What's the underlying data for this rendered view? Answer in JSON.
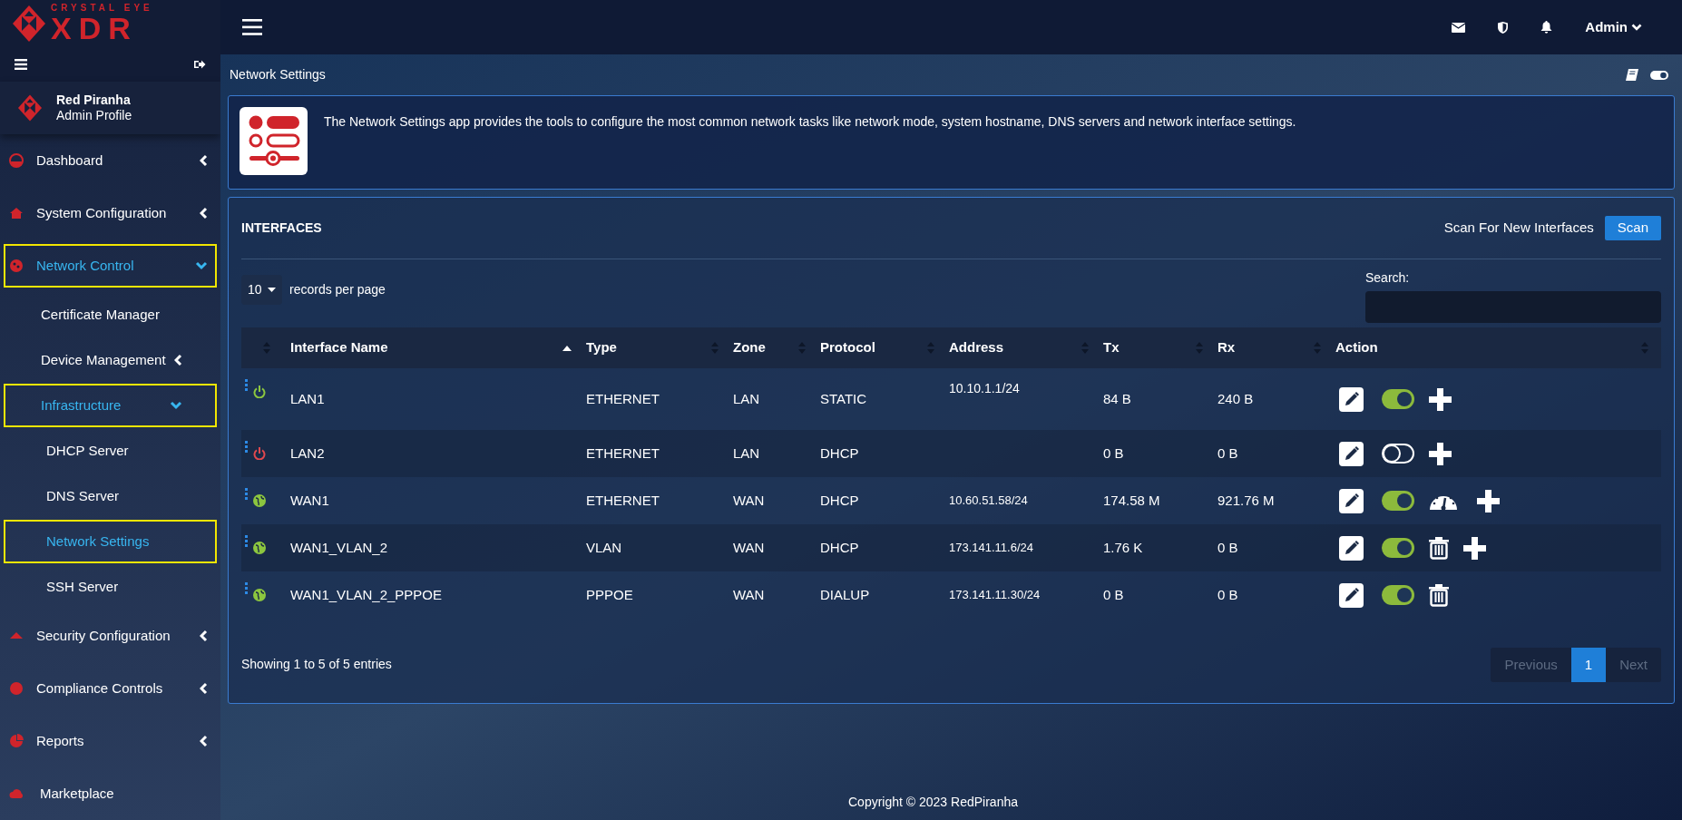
{
  "brand": {
    "top": "CRYSTAL EYE",
    "main": "XDR"
  },
  "topbar": {
    "user": "Admin"
  },
  "profile": {
    "name": "Red Piranha",
    "role": "Admin Profile"
  },
  "sidebar": {
    "items": [
      {
        "label": "Dashboard",
        "selected": false,
        "expanded": false
      },
      {
        "label": "System Configuration",
        "selected": false,
        "expanded": false
      },
      {
        "label": "Network Control",
        "selected": true,
        "expanded": true,
        "children": [
          {
            "label": "Certificate Manager",
            "selected": false
          },
          {
            "label": "Device Management",
            "selected": false,
            "expanded": false
          },
          {
            "label": "Infrastructure",
            "selected": true,
            "expanded": true,
            "children": [
              {
                "label": "DHCP Server",
                "selected": false
              },
              {
                "label": "DNS Server",
                "selected": false
              },
              {
                "label": "Network Settings",
                "selected": true
              },
              {
                "label": "SSH Server",
                "selected": false
              }
            ]
          }
        ]
      },
      {
        "label": "Security Configuration",
        "selected": false,
        "expanded": false
      },
      {
        "label": "Compliance Controls",
        "selected": false,
        "expanded": false
      },
      {
        "label": "Reports",
        "selected": false,
        "expanded": false
      },
      {
        "label": "Marketplace",
        "selected": false
      }
    ]
  },
  "page": {
    "title": "Network Settings",
    "theme_toggle_on": true
  },
  "info": {
    "text": "The Network Settings app provides the tools to configure the most common network tasks like network mode, system hostname, DNS servers and network interface settings."
  },
  "interfaces": {
    "title": "INTERFACES",
    "scan_label": "Scan For New Interfaces",
    "scan_button": "Scan",
    "page_size": "10",
    "page_size_label": "records per page",
    "search_label": "Search:",
    "columns": [
      {
        "sorted_ascending": false
      },
      {
        "label": "Interface Name",
        "sorted_ascending": true
      },
      {
        "label": "Type",
        "sorted_ascending": false
      },
      {
        "label": "Zone",
        "sorted_ascending": false
      },
      {
        "label": "Protocol",
        "sorted_ascending": false
      },
      {
        "label": "Address",
        "sorted_ascending": false
      },
      {
        "label": "Tx",
        "sorted_ascending": false
      },
      {
        "label": "Rx",
        "sorted_ascending": false
      },
      {
        "label": "Action",
        "sorted_ascending": false
      }
    ],
    "rows": [
      {
        "kind": "power",
        "up": true,
        "name": "LAN1",
        "type": "ETHERNET",
        "zone": "LAN",
        "protocol": "STATIC",
        "address": "10.10.1.1/24",
        "tx": "84 B",
        "rx": "240 B",
        "enabled": true,
        "actions": [
          {
            "kind": "edit"
          },
          {
            "kind": "toggle"
          },
          {
            "kind": "add"
          }
        ]
      },
      {
        "kind": "power",
        "up": false,
        "name": "LAN2",
        "type": "ETHERNET",
        "zone": "LAN",
        "protocol": "DHCP",
        "tx": "0 B",
        "rx": "0 B",
        "enabled": false,
        "actions": [
          {
            "kind": "edit"
          },
          {
            "kind": "toggle"
          },
          {
            "kind": "add"
          }
        ]
      },
      {
        "kind": "globe",
        "up": true,
        "name": "WAN1",
        "type": "ETHERNET",
        "zone": "WAN",
        "protocol": "DHCP",
        "address": "10.60.51.58/24",
        "tx": "174.58 M",
        "rx": "921.76 M",
        "enabled": true,
        "actions": [
          {
            "kind": "edit"
          },
          {
            "kind": "toggle"
          },
          {
            "kind": "gauge"
          },
          {
            "kind": "add"
          }
        ]
      },
      {
        "kind": "globe",
        "up": true,
        "name": "WAN1_VLAN_2",
        "type": "VLAN",
        "zone": "WAN",
        "protocol": "DHCP",
        "address": "173.141.11.6/24",
        "tx": "1.76 K",
        "rx": "0 B",
        "enabled": true,
        "actions": [
          {
            "kind": "edit"
          },
          {
            "kind": "toggle"
          },
          {
            "kind": "delete"
          },
          {
            "kind": "add"
          }
        ]
      },
      {
        "kind": "globe",
        "up": true,
        "name": "WAN1_VLAN_2_PPPOE",
        "type": "PPPOE",
        "zone": "WAN",
        "protocol": "DIALUP",
        "address": "173.141.11.30/24",
        "tx": "0 B",
        "rx": "0 B",
        "enabled": true,
        "actions": [
          {
            "kind": "edit"
          },
          {
            "kind": "toggle"
          },
          {
            "kind": "delete"
          }
        ]
      }
    ],
    "summary": "Showing 1 to 5 of 5 entries",
    "pagination": [
      {
        "label": "Previous",
        "selected": false,
        "disabled": true
      },
      {
        "label": "1",
        "selected": true,
        "disabled": false
      },
      {
        "label": "Next",
        "selected": false,
        "disabled": true
      }
    ]
  },
  "footer": "Copyright © 2023 RedPiranha"
}
